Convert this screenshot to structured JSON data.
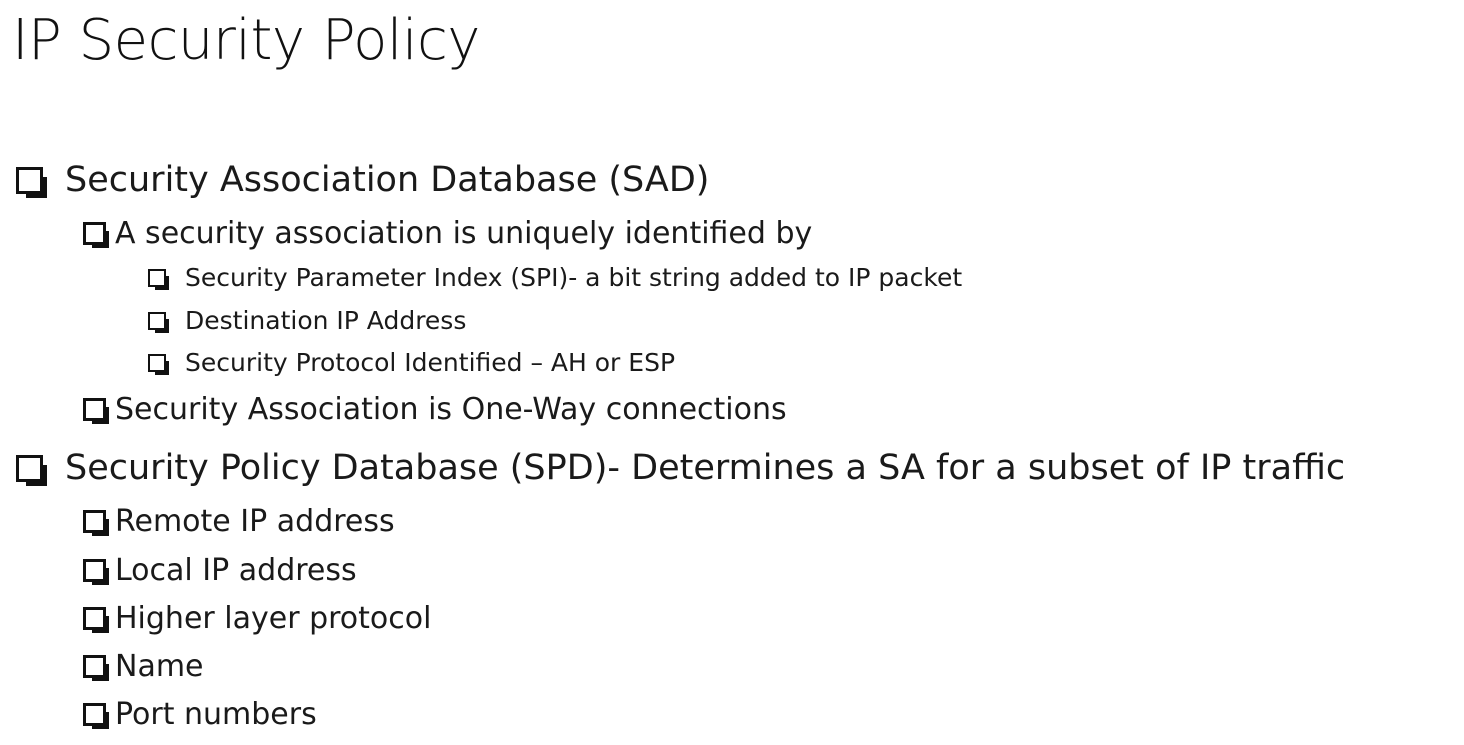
{
  "slide": {
    "title": "IP Security Policy",
    "bullets": [
      {
        "text": "Security Association Database (SAD)"
      },
      {
        "text": "A security association is uniquely identified by"
      },
      {
        "text": "Security Parameter Index (SPI)- a bit string added to IP packet"
      },
      {
        "text": "Destination IP Address"
      },
      {
        "text": "Security Protocol Identified – AH or ESP"
      },
      {
        "text": "Security Association is One-Way connections"
      },
      {
        "text": "Security Policy Database (SPD)- Determines a SA for a subset of IP traffic"
      },
      {
        "text": "Remote IP address"
      },
      {
        "text": "Local IP address"
      },
      {
        "text": "Higher layer protocol"
      },
      {
        "text": "Name"
      },
      {
        "text": "Port numbers"
      }
    ]
  }
}
